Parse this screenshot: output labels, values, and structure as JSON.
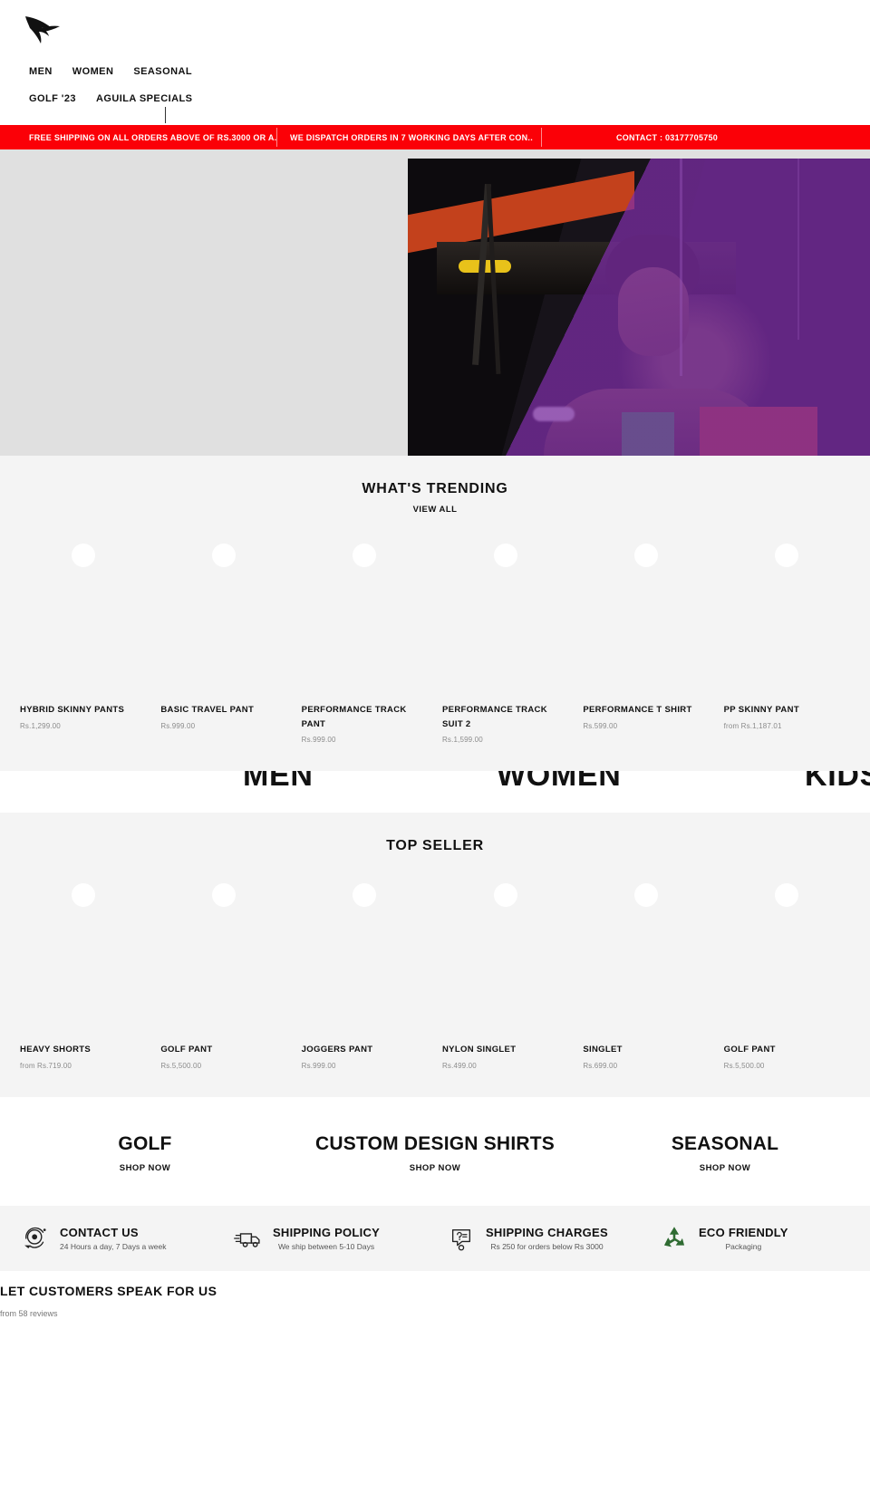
{
  "header": {
    "logo_icon": "eagle-logo-icon",
    "nav_row_1": [
      {
        "label": "MEN"
      },
      {
        "label": "WOMEN"
      },
      {
        "label": "SEASONAL"
      }
    ],
    "nav_row_2": [
      {
        "label": "GOLF '23"
      },
      {
        "label": "AGUILA SPECIALS"
      }
    ]
  },
  "announcement": {
    "background": "#fb0007",
    "items": [
      {
        "text": "FREE SHIPPING ON ALL ORDERS ABOVE OF RS.3000 OR A."
      },
      {
        "text": "WE DISPATCH ORDERS IN 7 WORKING DAYS AFTER CON.."
      },
      {
        "text": "CONTACT : 03177705750"
      }
    ]
  },
  "hero": {
    "background": "#e0e0e0"
  },
  "trending": {
    "title": "WHAT'S TRENDING",
    "view_all": "VIEW ALL",
    "products": [
      {
        "title": "HYBRID SKINNY PANTS",
        "price": "Rs.1,299.00"
      },
      {
        "title": "BASIC TRAVEL PANT",
        "price": "Rs.999.00"
      },
      {
        "title": "PERFORMANCE TRACK PANT",
        "price": "Rs.999.00"
      },
      {
        "title": "PERFORMANCE TRACK SUIT 2",
        "price": "Rs.1,599.00"
      },
      {
        "title": "PERFORMANCE T SHIRT",
        "price": "Rs.599.00"
      },
      {
        "title": "PP SKINNY PANT",
        "price": "from Rs.1,187.01"
      }
    ]
  },
  "categories": [
    {
      "label": "MEN"
    },
    {
      "label": "WOMEN"
    },
    {
      "label": "KIDS"
    }
  ],
  "top_seller": {
    "title": "TOP SELLER",
    "products": [
      {
        "title": "HEAVY SHORTS",
        "price": "from Rs.719.00"
      },
      {
        "title": "GOLF PANT",
        "price": "Rs.5,500.00"
      },
      {
        "title": "JOGGERS PANT",
        "price": "Rs.999.00"
      },
      {
        "title": "NYLON SINGLET",
        "price": "Rs.499.00"
      },
      {
        "title": "SINGLET",
        "price": "Rs.699.00"
      },
      {
        "title": "GOLF PANT",
        "price": "Rs.5,500.00"
      }
    ]
  },
  "promos": [
    {
      "title": "GOLF",
      "cta": "SHOP NOW"
    },
    {
      "title": "CUSTOM DESIGN SHIRTS",
      "cta": "SHOP NOW"
    },
    {
      "title": "SEASONAL",
      "cta": "SHOP NOW"
    }
  ],
  "services": [
    {
      "icon": "headset-support-icon",
      "title": "CONTACT US",
      "subtitle": "24 Hours a day, 7 Days a week"
    },
    {
      "icon": "delivery-truck-icon",
      "title": "SHIPPING POLICY",
      "subtitle": "We ship between 5-10 Days"
    },
    {
      "icon": "question-chat-icon",
      "title": "SHIPPING CHARGES",
      "subtitle": "Rs 250 for orders below Rs 3000"
    },
    {
      "icon": "recycle-icon",
      "title": "ECO FRIENDLY",
      "subtitle": "Packaging"
    }
  ],
  "reviews": {
    "title": "LET CUSTOMERS SPEAK FOR US",
    "subtitle": "from 58 reviews"
  }
}
